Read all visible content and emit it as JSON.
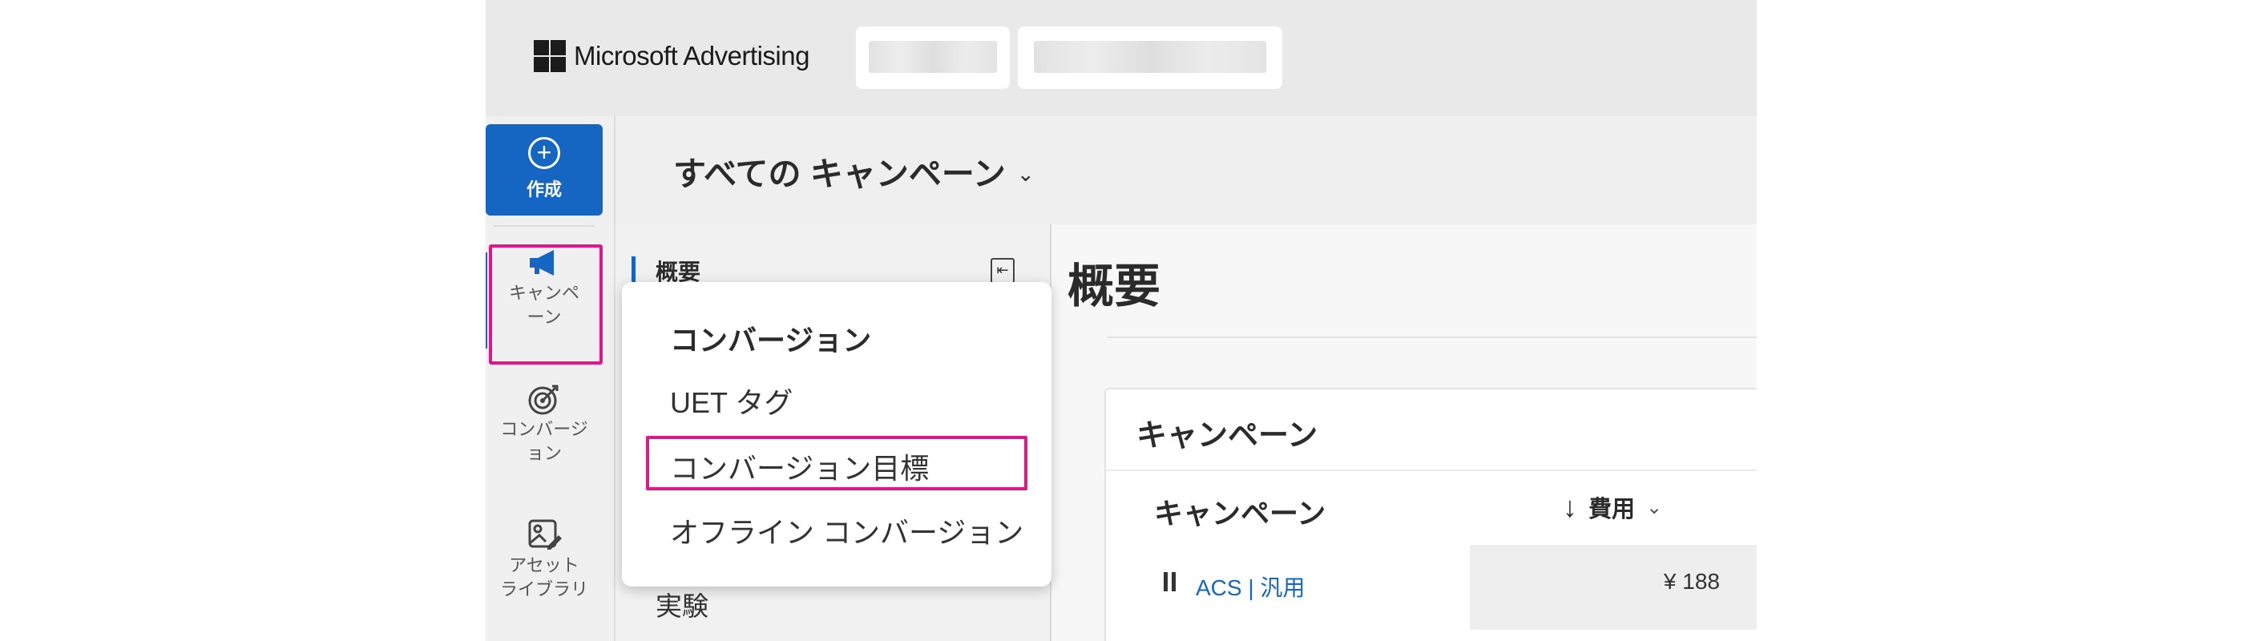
{
  "header": {
    "brand": "Microsoft Advertising"
  },
  "rail": {
    "create_label": "作成",
    "items": [
      {
        "label": "キャンペーン"
      },
      {
        "label": "コンバージョン"
      },
      {
        "label": "アセット ライブラリ"
      }
    ]
  },
  "page": {
    "campaign_selector": "すべての キャンペーン",
    "title": "概要"
  },
  "subnav": {
    "overview": "概要",
    "experiments": "実験"
  },
  "menu": {
    "header": "コンバージョン",
    "items": [
      "UET タグ",
      "コンバージョン目標",
      "オフライン コンバージョン"
    ]
  },
  "card": {
    "title": "キャンペーン",
    "columns": {
      "campaign": "キャンペーン",
      "cost": "費用"
    },
    "rows": [
      {
        "name": "ACS | 汎用",
        "cost": "¥ 188"
      }
    ]
  },
  "colors": {
    "accent": "#1466c2",
    "highlight": "#e0168a"
  }
}
